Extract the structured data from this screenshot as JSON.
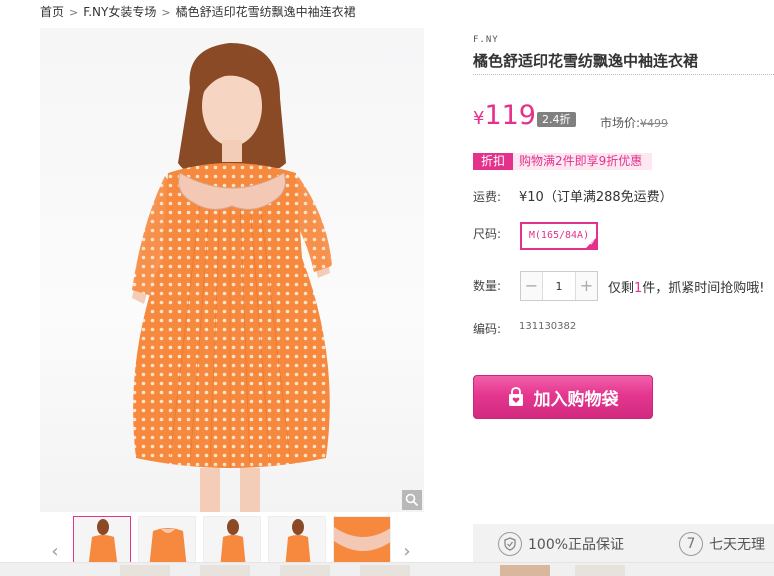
{
  "breadcrumb": {
    "items": [
      "首页",
      "F.NY女装专场",
      "橘色舒适印花雪纺飘逸中袖连衣裙"
    ],
    "separator": ">"
  },
  "product": {
    "brand": "F.NY",
    "title": "橘色舒适印花雪纺飘逸中袖连衣裙",
    "currency": "¥",
    "price": "119",
    "discount": "2.4折",
    "market_price_label": "市场价:",
    "market_price": "¥499",
    "promo_tag": "折扣",
    "promo_text": "购物满2件即享9折优惠",
    "shipping_label": "运费:",
    "shipping_value": "¥10（订单满288免运费）",
    "size_label": "尺码:",
    "size_selected": "M(165/84A)",
    "qty_label": "数量:",
    "qty_value": "1",
    "stock_prefix": "仅剩",
    "stock_count": "1",
    "stock_suffix": "件，抓紧时间抢购哦!",
    "sku_label": "编码:",
    "sku_value": "131130382",
    "add_to_cart": "加入购物袋"
  },
  "assurance": {
    "genuine": "100%正品保证",
    "return_num": "7",
    "return_text": "七天无理"
  },
  "icons": {
    "zoom": "magnifier-icon",
    "prev": "chevron-left-icon",
    "next": "chevron-right-icon",
    "bag": "shopping-bag-icon",
    "shield": "shield-icon"
  },
  "colors": {
    "accent": "#e4318c",
    "dress": "#f7893e",
    "badge_gray": "#808080"
  }
}
